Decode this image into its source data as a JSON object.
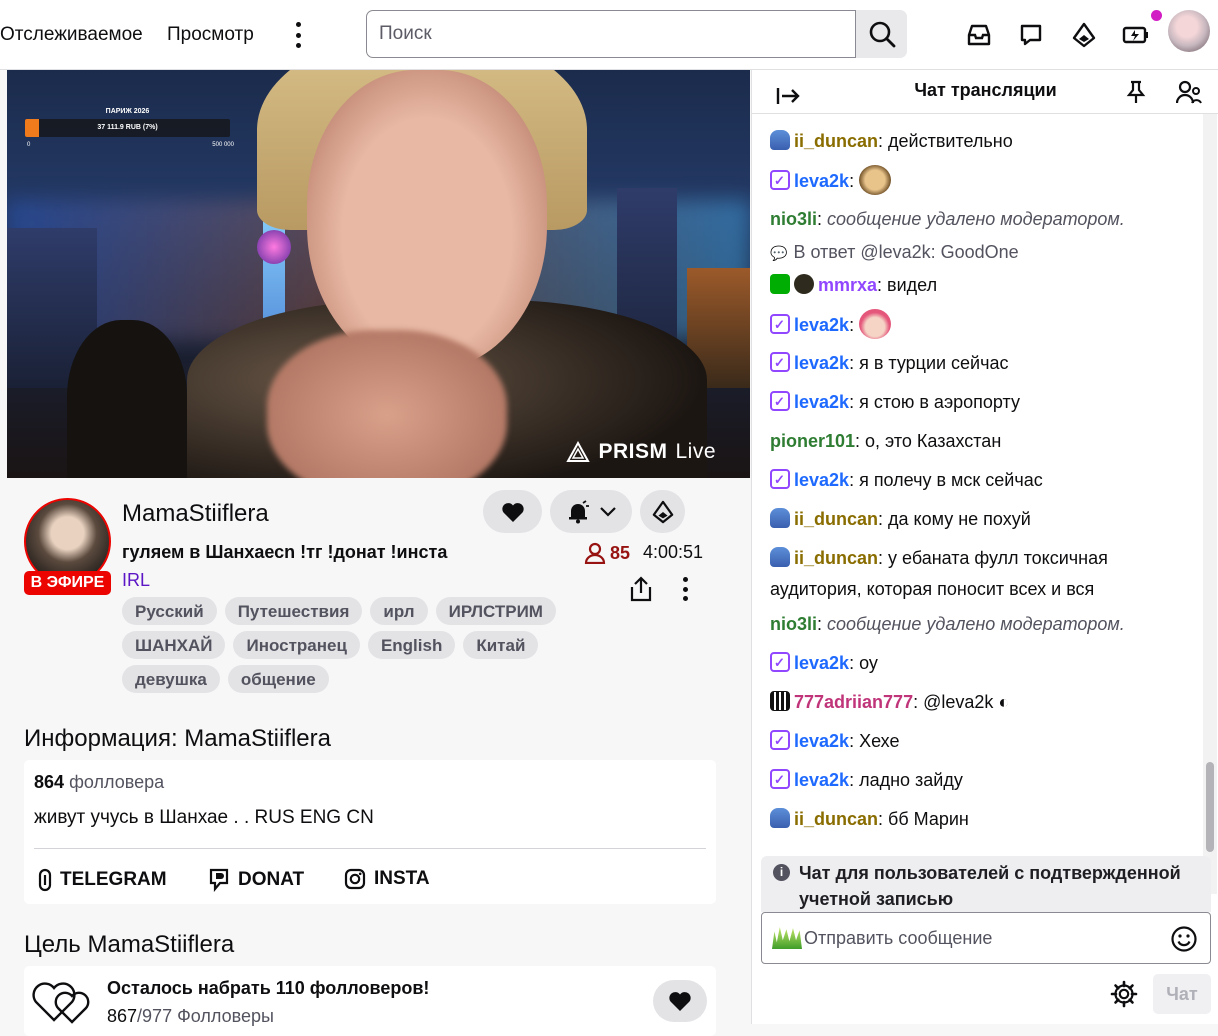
{
  "nav": {
    "following": "Отслеживаемое",
    "browse": "Просмотр",
    "search_placeholder": "Поиск"
  },
  "player": {
    "goal_title": "ПАРИЖ 2026",
    "goal_text": "37 111.9 RUB (7%)",
    "goal_min": "0",
    "goal_max": "500 000",
    "goal_progress": 0.07,
    "watermark_brand": "PRISM",
    "watermark_suffix": "Live"
  },
  "channel": {
    "name": "MamaStiiflera",
    "live_badge": "В ЭФИРЕ",
    "title": "гуляем в Шанхаесn !тг !донат !инста",
    "category": "IRL",
    "viewers": "85",
    "uptime": "4:00:51",
    "tags": [
      "Русский",
      "Путешествия",
      "ирл",
      "ИРЛСТРИМ",
      "ШАНХАЙ",
      "Иностранец",
      "English",
      "Китай",
      "девушка",
      "общение"
    ]
  },
  "about": {
    "heading_prefix": "Информация: ",
    "heading_name": "MamaStiiflera",
    "followers_count": "864",
    "followers_label": "фолловера",
    "bio": "живут учусь в Шанхае .      . RUS ENG CN",
    "links": [
      "TELEGRAM",
      "DONAT",
      "INSTA"
    ]
  },
  "goal": {
    "heading_prefix": "Цель ",
    "heading_name": "MamaStiiflera",
    "title": "Осталось набрать 110 фолловеров!",
    "current": "867",
    "target": "/977 Фолловеры"
  },
  "chat": {
    "title": "Чат трансляции",
    "messages": [
      {
        "badge": "gift",
        "user": "ii_duncan",
        "color": "#8a6d00",
        "text": ": действительно"
      },
      {
        "badge": "sub",
        "user": "leva2k",
        "color": "#1e69ff",
        "text": ": ",
        "emote": "dog"
      },
      {
        "badge": "",
        "user": "nio3li",
        "color": "#2e7d32",
        "text": ": ",
        "deleted": "сообщение удалено модератором."
      },
      {
        "reply": "В ответ @leva2k: GoodOne"
      },
      {
        "badge": "mod",
        "badge2": "vip",
        "user": "mmrxa",
        "color": "#9147ff",
        "text": ": видел"
      },
      {
        "badge": "sub",
        "user": "leva2k",
        "color": "#1e69ff",
        "text": ": ",
        "emote": "girl"
      },
      {
        "badge": "sub",
        "user": "leva2k",
        "color": "#1e69ff",
        "text": ": я в турции сейчас"
      },
      {
        "badge": "sub",
        "user": "leva2k",
        "color": "#1e69ff",
        "text": ": я стою в аэропорту"
      },
      {
        "badge": "",
        "user": "pioner101",
        "color": "#2e7d32",
        "text": ": о, это Казахстан"
      },
      {
        "badge": "sub",
        "user": "leva2k",
        "color": "#1e69ff",
        "text": ": я полечу в мск сейчас"
      },
      {
        "badge": "gift",
        "user": "ii_duncan",
        "color": "#8a6d00",
        "text": ": да кому не похуй"
      },
      {
        "badge": "gift",
        "user": "ii_duncan",
        "color": "#8a6d00",
        "text": ": у ебаната фулл токсичная аудитория, которая поносит всех и вся"
      },
      {
        "badge": "",
        "user": "nio3li",
        "color": "#2e7d32",
        "text": ": ",
        "deleted": "сообщение удалено модератором."
      },
      {
        "badge": "sub",
        "user": "leva2k",
        "color": "#1e69ff",
        "text": ": оу"
      },
      {
        "badge": "qr",
        "user": "777adriian777",
        "color": "#c0357a",
        "text": ": @leva2k ◐"
      },
      {
        "badge": "sub",
        "user": "leva2k",
        "color": "#1e69ff",
        "text": ": Хехе"
      },
      {
        "badge": "sub",
        "user": "leva2k",
        "color": "#1e69ff",
        "text": ": ладно зайду"
      },
      {
        "badge": "gift",
        "user": "ii_duncan",
        "color": "#8a6d00",
        "text": ": бб Марин"
      }
    ],
    "verify_note": "Чат для пользователей с подтвержденной учетной записью",
    "input_placeholder": "Отправить сообщение",
    "send_label": "Чат"
  }
}
